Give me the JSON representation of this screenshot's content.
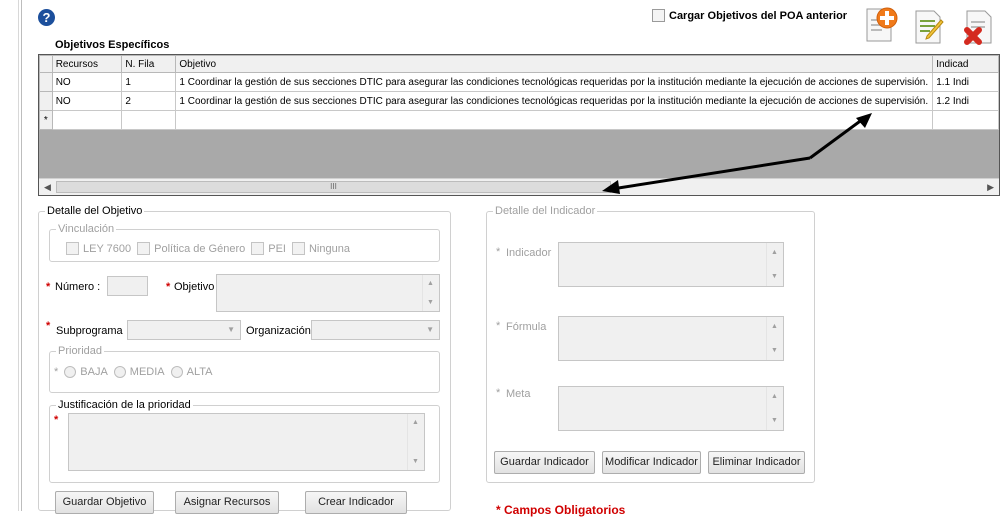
{
  "header": {
    "help_icon": "question-circle-icon",
    "load_previous_label": "Cargar Objetivos del POA anterior",
    "section_title": "Objetivos Específicos",
    "toolbar_icons": [
      "document-add-icon",
      "document-edit-icon",
      "document-delete-icon"
    ]
  },
  "grid": {
    "columns": [
      "Recursos",
      "N. Fila",
      "Objetivo",
      "Indicad"
    ],
    "rows": [
      {
        "recursos": "NO",
        "fila": "1",
        "objetivo": "1 Coordinar la gestión de sus secciones DTIC para asegurar las condiciones tecnológicas requeridas por la institución mediante la ejecución de acciones de supervisión.",
        "indicador": "1.1 Indi"
      },
      {
        "recursos": "NO",
        "fila": "2",
        "objetivo": "1 Coordinar la gestión de sus secciones DTIC para asegurar las condiciones tecnológicas requeridas por la institución mediante la ejecución de acciones de supervisión.",
        "indicador": "1.2 Indi"
      }
    ],
    "new_row_marker": "*",
    "scroll_thumb_label": "III"
  },
  "detalle_objetivo": {
    "legend": "Detalle del Objetivo",
    "vinculacion_legend": "Vinculación",
    "vinculacion_options": [
      "LEY 7600",
      "Política de Género",
      "PEI",
      "Ninguna"
    ],
    "numero_label": "Número :",
    "objetivo_label": "Objetivo",
    "subprograma_label": "Subprograma",
    "organizacion_label": "Organización",
    "prioridad_legend": "Prioridad",
    "prioridad_options": [
      "BAJA",
      "MEDIA",
      "ALTA"
    ],
    "justificacion_legend": "Justificación de la prioridad",
    "required_mark": "*",
    "buttons": {
      "guardar": "Guardar Objetivo",
      "asignar": "Asignar Recursos",
      "crear": "Crear Indicador"
    }
  },
  "detalle_indicador": {
    "legend": "Detalle del Indicador",
    "indicador_label": "Indicador",
    "formula_label": "Fórmula",
    "meta_label": "Meta",
    "buttons": {
      "guardar": "Guardar Indicador",
      "modificar": "Modificar Indicador",
      "eliminar": "Eliminar Indicador"
    }
  },
  "footer": {
    "required_note": "* Campos Obligatorios"
  }
}
